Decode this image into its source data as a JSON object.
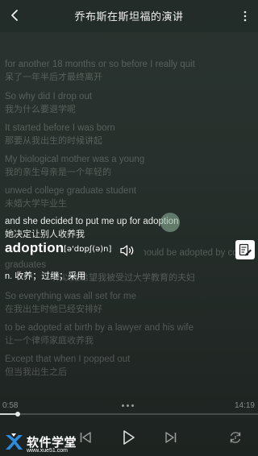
{
  "header": {
    "title": "乔布斯在斯坦福的演讲"
  },
  "lyrics": [
    {
      "en": "for another 18 months or so before I really quit",
      "zh": "呆了一年半后才最终离开",
      "state": "dim"
    },
    {
      "en": "So why did I drop out",
      "zh": "我为什么要退学呢",
      "state": "dim"
    },
    {
      "en": "It started before I was born",
      "zh": "那要从我出生的时候讲起",
      "state": "dim"
    },
    {
      "en": "My biological mother was a young",
      "zh": "我的亲生母亲是一个年轻的",
      "state": "dim"
    },
    {
      "en": "unwed college graduate student",
      "zh": "未婚大学毕业生",
      "state": "dim"
    },
    {
      "en": "and she decided to put me up for adoption",
      "zh": "她决定让别人收养我",
      "state": "active"
    },
    {
      "en": "she felt very strongly that I should be adopted by college",
      "zh": "",
      "state": "dim"
    },
    {
      "en": "graduates",
      "zh": "所以她希望我被受过大学教育的夫妇",
      "state": "dim"
    },
    {
      "en": "So everything was all set for me",
      "zh": "在我出生时他已经安排好",
      "state": "dim"
    },
    {
      "en": "to be adopted at birth by a lawyer and his wife",
      "zh": "让一个律师家庭收养我",
      "state": "dim"
    },
    {
      "en": "Except that when I popped out",
      "zh": "但当我出生之后",
      "state": "dim"
    }
  ],
  "word_popup": {
    "word": "adoption",
    "phonetic": "[ə'dɒpʃ(ə)n]",
    "definition": "n. 收养；过继；采用"
  },
  "player": {
    "current_time": "0:58",
    "total_time": "14:19",
    "progress": 0.068
  },
  "icons": {
    "back": "back-icon",
    "more": "more-vertical-icon",
    "speaker": "speaker-icon",
    "note": "note-edit-icon",
    "prev": "skip-previous-icon",
    "play": "play-icon",
    "next": "skip-next-icon",
    "loop": "loop-icon"
  },
  "watermark": {
    "title": "软件学堂",
    "url": "www.xue51.com"
  }
}
